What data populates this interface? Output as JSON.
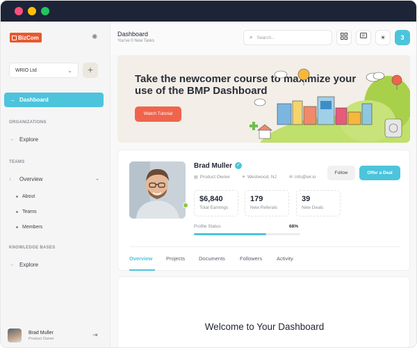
{
  "window": {
    "controls": [
      "close",
      "minimize",
      "maximize"
    ]
  },
  "sidebar": {
    "logo_text": "BizCom",
    "org_select_value": "WRIO Ltd",
    "add_button_label": "+",
    "nav_active_label": "Dashboard",
    "sections": {
      "organizations": "ORGANIZATIONS",
      "teams": "TEAMS",
      "knowledge_bases": "KNOWLEDGE BASES"
    },
    "org_explore": "Explore",
    "teams_overview": "Overview",
    "teams_sub": [
      "About",
      "Teams",
      "Members"
    ],
    "kb_explore": "Explore",
    "user": {
      "name": "Brad Muller",
      "role": "Product Owner"
    }
  },
  "header": {
    "title": "Dashboard",
    "subtitle": "You've 0 New Tasks",
    "search_placeholder": "Search...",
    "notification_count": "3",
    "icons": [
      "grid-icon",
      "chat-icon",
      "sun-icon"
    ]
  },
  "banner": {
    "title": "Take the newcomer course to maximize your use of the BMP Dashboard",
    "button_label": "Watch Tutorial"
  },
  "profile": {
    "name": "Brad Muller",
    "role": "Product Owner",
    "location": "Westwood, NJ",
    "email": "info@wr.io",
    "follow_label": "Follow",
    "offer_label": "Offer a Deal",
    "stats": [
      {
        "value": "$6,840",
        "label": "Total Earnings"
      },
      {
        "value": "179",
        "label": "New Referals"
      },
      {
        "value": "39",
        "label": "New Deals"
      }
    ],
    "profile_status_label": "Profile Status",
    "profile_status_value": "68%",
    "profile_status_fraction": 0.68,
    "tabs": [
      "Overview",
      "Projects",
      "Documents",
      "Followers",
      "Activity"
    ],
    "active_tab": "Overview"
  },
  "welcome": {
    "title": "Welcome to Your Dashboard"
  },
  "colors": {
    "accent": "#4cc4dc",
    "cta": "#f0644d",
    "logo": "#e8582d",
    "titlebar": "#1d2438",
    "online": "#8dc63f"
  }
}
